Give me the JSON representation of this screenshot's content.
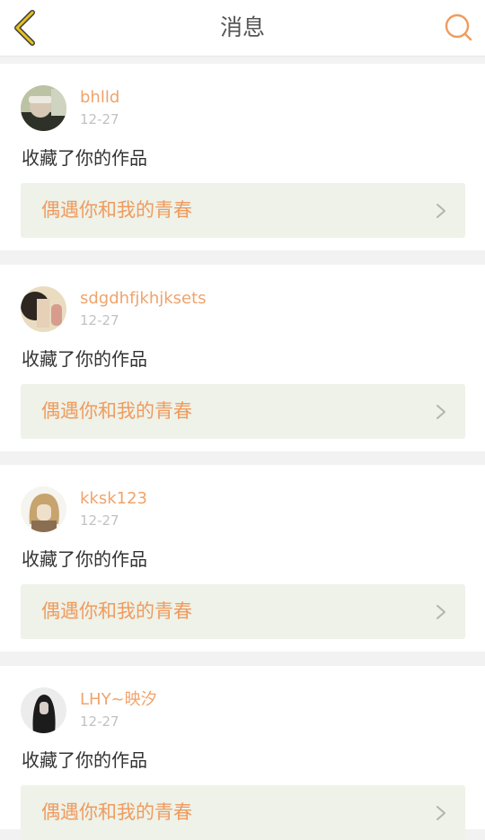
{
  "header": {
    "title": "消息",
    "back_icon": "chevron-left-icon",
    "search_icon": "search-icon"
  },
  "colors": {
    "accent": "#ef9b5f",
    "back_arrow": "#e8c21b",
    "card_link_bg": "#eef2e8",
    "page_bg": "#f2f2f2"
  },
  "messages": [
    {
      "user": "bhlld",
      "date": "12-27",
      "action": "收藏了你的作品",
      "work_title": "偶遇你和我的青春"
    },
    {
      "user": "sdgdhfjkhjksets",
      "date": "12-27",
      "action": "收藏了你的作品",
      "work_title": "偶遇你和我的青春"
    },
    {
      "user": "kksk123",
      "date": "12-27",
      "action": "收藏了你的作品",
      "work_title": "偶遇你和我的青春"
    },
    {
      "user": "LHY~映汐",
      "date": "12-27",
      "action": "收藏了你的作品",
      "work_title": "偶遇你和我的青春"
    }
  ]
}
